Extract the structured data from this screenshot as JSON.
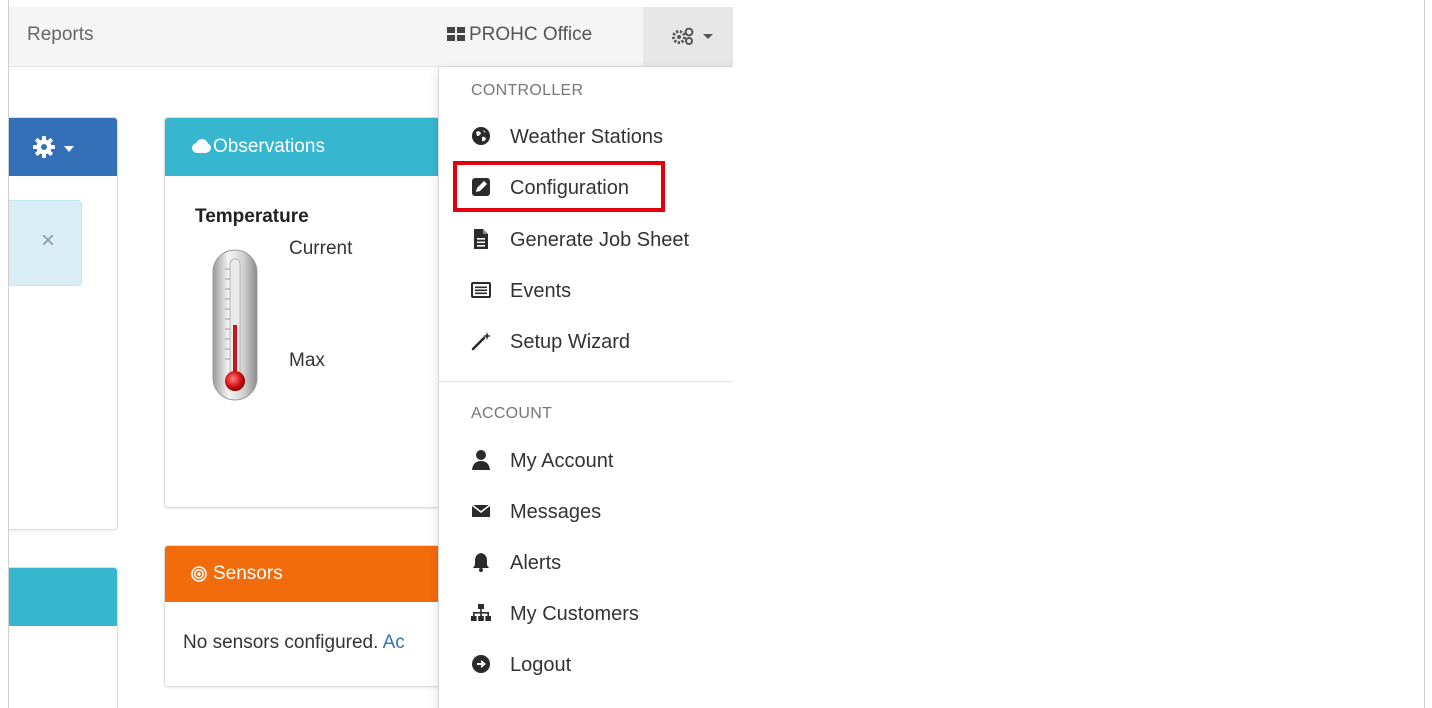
{
  "navbar": {
    "reports_label": "Reports",
    "office_label": "PROHC Office",
    "office_icon": "th-large-icon",
    "settings_icon": "cogs-icon"
  },
  "panels": {
    "observations": {
      "title": "Observations",
      "icon": "cloud-icon",
      "color": "#36b7cf",
      "temperature_label": "Temperature",
      "current_label": "Current",
      "max_label": "Max"
    },
    "sensors": {
      "title": "Sensors",
      "icon": "sensor-icon",
      "color": "#f36c0c",
      "empty_text": "No sensors configured.",
      "add_link_text": "Ac"
    },
    "left_panel_color": "#3470b8",
    "alert_close": "×"
  },
  "dropdown": {
    "controller_header": "CONTROLLER",
    "controller_items": [
      {
        "label": "Weather Stations",
        "icon": "globe-icon"
      },
      {
        "label": "Configuration",
        "icon": "edit-icon"
      },
      {
        "label": "Generate Job Sheet",
        "icon": "file-icon"
      },
      {
        "label": "Events",
        "icon": "list-alt-icon"
      },
      {
        "label": "Setup Wizard",
        "icon": "magic-wand-icon"
      }
    ],
    "account_header": "ACCOUNT",
    "account_items": [
      {
        "label": "My Account",
        "icon": "user-icon"
      },
      {
        "label": "Messages",
        "icon": "envelope-icon"
      },
      {
        "label": "Alerts",
        "icon": "bell-icon"
      },
      {
        "label": "My Customers",
        "icon": "sitemap-icon"
      },
      {
        "label": "Logout",
        "icon": "logout-icon"
      }
    ],
    "highlighted_item": "Configuration",
    "highlight_color": "#e0000e"
  }
}
